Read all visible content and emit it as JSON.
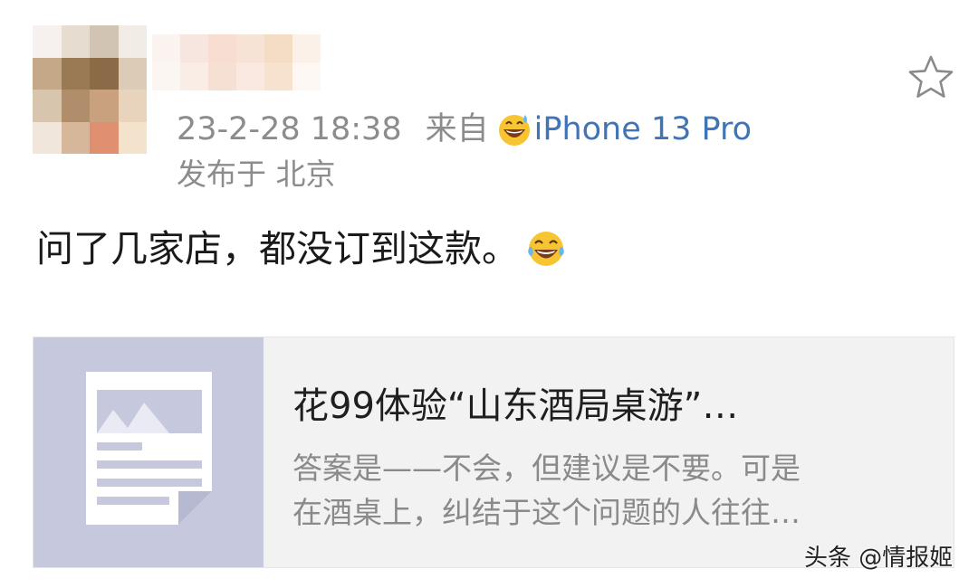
{
  "post": {
    "timestamp": "23-2-28 18:38",
    "source_prefix": "来自",
    "device": "iPhone 13 Pro",
    "location": "发布于 北京",
    "text": "问了几家店，都没订到这款。"
  },
  "icons": {
    "favorite": "star-outline-icon",
    "device_emoji": "grinning-sweat-emoji",
    "text_emoji": "tears-of-joy-emoji",
    "card_thumb": "document-image-icon"
  },
  "link_card": {
    "title": "花99体验“山东酒局桌游”…",
    "summary_line1": "答案是——不会，但建议是不要。可是",
    "summary_line2": "在酒桌上，纠结于这个问题的人往往…"
  },
  "watermark": "头条 @情报姬",
  "colors": {
    "meta_gray": "#8c8c8c",
    "device_link": "#3f74b8",
    "card_bg": "#f2f2f2",
    "thumb_bg": "#c6c9de"
  }
}
